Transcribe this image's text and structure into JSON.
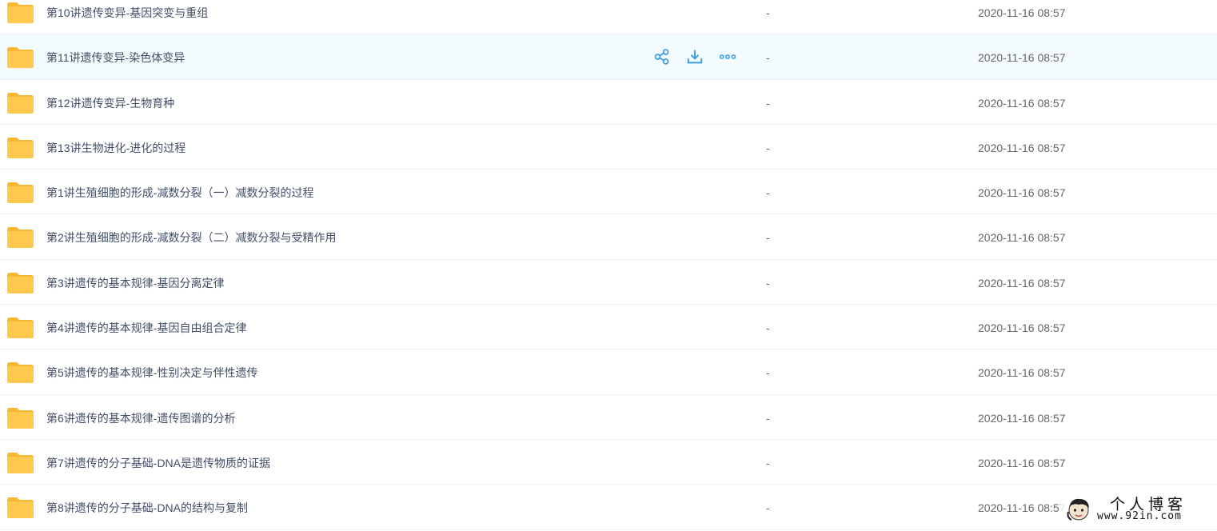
{
  "files": [
    {
      "name": "第10讲遗传变异-基因突变与重组",
      "size": "-",
      "time": "2020-11-16 08:57",
      "hovered": false
    },
    {
      "name": "第11讲遗传变异-染色体变异",
      "size": "-",
      "time": "2020-11-16 08:57",
      "hovered": true
    },
    {
      "name": "第12讲遗传变异-生物育种",
      "size": "-",
      "time": "2020-11-16 08:57",
      "hovered": false
    },
    {
      "name": "第13讲生物进化-进化的过程",
      "size": "-",
      "time": "2020-11-16 08:57",
      "hovered": false
    },
    {
      "name": "第1讲生殖细胞的形成-减数分裂（一）减数分裂的过程",
      "size": "-",
      "time": "2020-11-16 08:57",
      "hovered": false
    },
    {
      "name": "第2讲生殖细胞的形成-减数分裂（二）减数分裂与受精作用",
      "size": "-",
      "time": "2020-11-16 08:57",
      "hovered": false
    },
    {
      "name": "第3讲遗传的基本规律-基因分离定律",
      "size": "-",
      "time": "2020-11-16 08:57",
      "hovered": false
    },
    {
      "name": "第4讲遗传的基本规律-基因自由组合定律",
      "size": "-",
      "time": "2020-11-16 08:57",
      "hovered": false
    },
    {
      "name": "第5讲遗传的基本规律-性别决定与伴性遗传",
      "size": "-",
      "time": "2020-11-16 08:57",
      "hovered": false
    },
    {
      "name": "第6讲遗传的基本规律-遗传图谱的分析",
      "size": "-",
      "time": "2020-11-16 08:57",
      "hovered": false
    },
    {
      "name": "第7讲遗传的分子基础-DNA是遗传物质的证据",
      "size": "-",
      "time": "2020-11-16 08:57",
      "hovered": false
    },
    {
      "name": "第8讲遗传的分子基础-DNA的结构与复制",
      "size": "-",
      "time": "2020-11-16 08:57",
      "hovered": false
    }
  ],
  "row_actions": [
    {
      "icon": "share-icon"
    },
    {
      "icon": "download-icon"
    },
    {
      "icon": "more-icon"
    }
  ],
  "watermark": {
    "title": "个人博客",
    "url": "www.92in.com",
    "icon": "avatar-face-icon"
  },
  "colors": {
    "folder": "#ffc94d",
    "folder_back": "#f7b731",
    "accent": "#3ea0e4",
    "hover_bg": "#f4fbff"
  }
}
